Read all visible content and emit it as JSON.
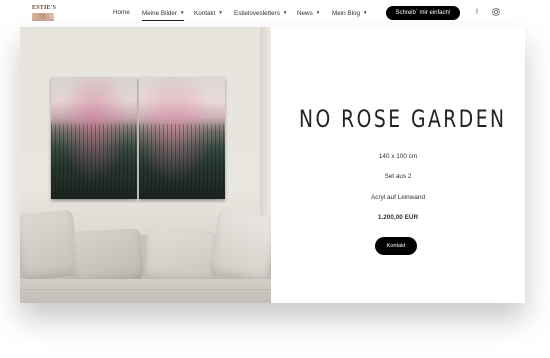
{
  "header": {
    "logo": {
      "text": "ESTIE'S"
    },
    "nav": [
      {
        "label": "Home",
        "dropdown": false,
        "active": false
      },
      {
        "label": "Meine Bilder",
        "dropdown": true,
        "active": true
      },
      {
        "label": "Kontakt",
        "dropdown": true,
        "active": false
      },
      {
        "label": "Estielovesletters",
        "dropdown": true,
        "active": false
      },
      {
        "label": "News",
        "dropdown": true,
        "active": false
      },
      {
        "label": "Mein Blog",
        "dropdown": true,
        "active": false
      }
    ],
    "caret_glyph": "▼",
    "cta_label": "Schreib` mir einfach!",
    "social": {
      "facebook_glyph": "f",
      "instagram_icon": "instagram-icon"
    }
  },
  "artwork": {
    "title": "NO ROSE GARDEN",
    "size": "140 x 100 cm",
    "set": "Set aus 2",
    "medium": "Acryl auf Leinwand",
    "price": "1.200,00 EUR",
    "contact_button_label": "Kontakt"
  },
  "colors": {
    "accent": "#000000",
    "text": "#222222",
    "background": "#ffffff"
  }
}
